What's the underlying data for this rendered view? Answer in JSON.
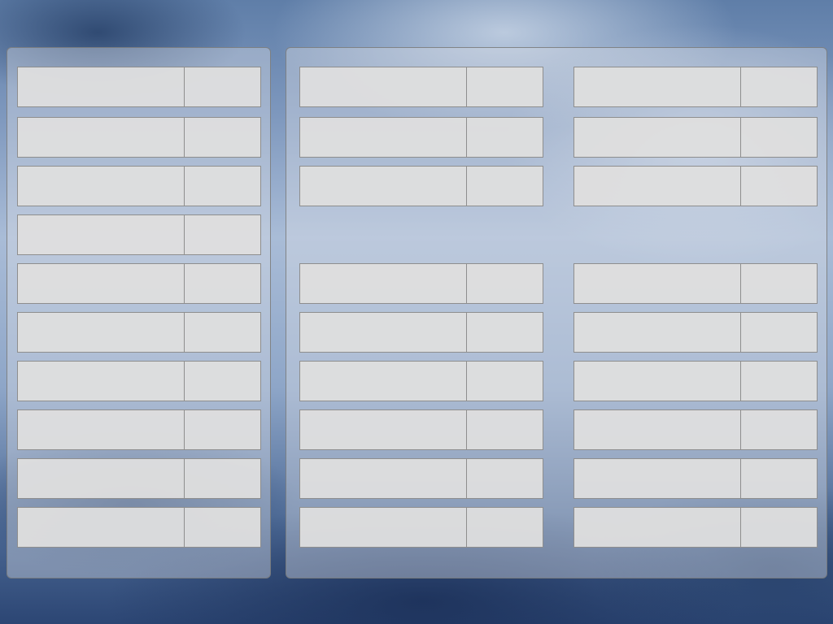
{
  "colors": {
    "panel_border": "#787878",
    "row_background": "#dedede",
    "row_border": "#8e8e8e"
  },
  "left_panel": {
    "rows": [
      {
        "name": "",
        "value": ""
      },
      {
        "name": "",
        "value": ""
      },
      {
        "name": "",
        "value": ""
      },
      {
        "name": "",
        "value": ""
      },
      {
        "name": "",
        "value": ""
      },
      {
        "name": "",
        "value": ""
      },
      {
        "name": "",
        "value": ""
      },
      {
        "name": "",
        "value": ""
      },
      {
        "name": "",
        "value": ""
      },
      {
        "name": "",
        "value": ""
      }
    ]
  },
  "right_panel": {
    "column_a": {
      "top_rows": [
        {
          "name": "",
          "value": ""
        },
        {
          "name": "",
          "value": ""
        },
        {
          "name": "",
          "value": ""
        }
      ],
      "bottom_rows": [
        {
          "name": "",
          "value": ""
        },
        {
          "name": "",
          "value": ""
        },
        {
          "name": "",
          "value": ""
        },
        {
          "name": "",
          "value": ""
        },
        {
          "name": "",
          "value": ""
        },
        {
          "name": "",
          "value": ""
        }
      ]
    },
    "column_b": {
      "top_rows": [
        {
          "name": "",
          "value": ""
        },
        {
          "name": "",
          "value": ""
        },
        {
          "name": "",
          "value": ""
        }
      ],
      "bottom_rows": [
        {
          "name": "",
          "value": ""
        },
        {
          "name": "",
          "value": ""
        },
        {
          "name": "",
          "value": ""
        },
        {
          "name": "",
          "value": ""
        },
        {
          "name": "",
          "value": ""
        },
        {
          "name": "",
          "value": ""
        }
      ]
    }
  }
}
